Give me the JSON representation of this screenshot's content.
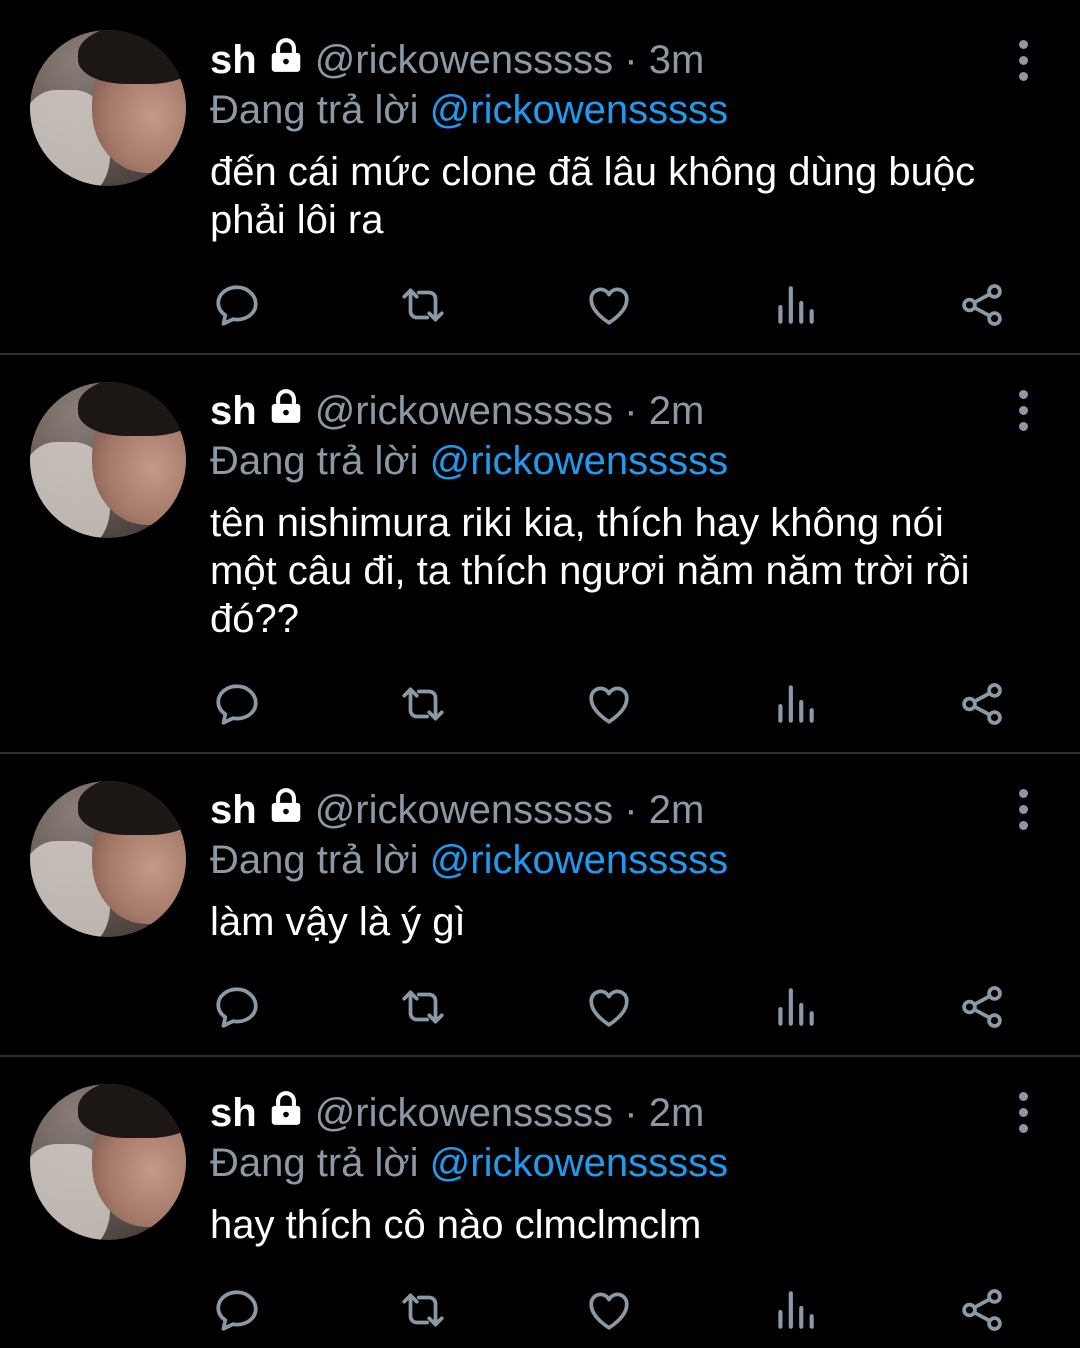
{
  "tweets": [
    {
      "name": "sh",
      "handle": "@rickowensssss",
      "dot": "·",
      "time": "3m",
      "reply_prefix": "Đang trả lời",
      "reply_to": "@rickowensssss",
      "text_lines": [
        "đến cái mức clone đã lâu không dùng buộc",
        "phải lôi ra"
      ]
    },
    {
      "name": "sh",
      "handle": "@rickowensssss",
      "dot": "·",
      "time": "2m",
      "reply_prefix": "Đang trả lời",
      "reply_to": "@rickowensssss",
      "text_lines": [
        "tên nishimura riki kia, thích hay không nói",
        "một câu đi, ta thích ngươi năm năm trời rồi",
        "đó??"
      ]
    },
    {
      "name": "sh",
      "handle": "@rickowensssss",
      "dot": "·",
      "time": "2m",
      "reply_prefix": "Đang trả lời",
      "reply_to": "@rickowensssss",
      "text_lines": [
        "làm vậy là ý gì"
      ]
    },
    {
      "name": "sh",
      "handle": "@rickowensssss",
      "dot": "·",
      "time": "2m",
      "reply_prefix": "Đang trả lời",
      "reply_to": "@rickowensssss",
      "text_lines": [
        "hay thích cô nào clmclmclm"
      ]
    }
  ],
  "icons": {
    "lock": "lock-icon",
    "more": "more-vertical-icon",
    "reply": "reply-icon",
    "retweet": "retweet-icon",
    "like": "heart-icon",
    "views": "analytics-icon",
    "share": "share-icon"
  },
  "colors": {
    "background": "#000000",
    "secondary_text": "#8b98a5",
    "mention": "#1d9bf0",
    "divider": "#2a2f33"
  }
}
